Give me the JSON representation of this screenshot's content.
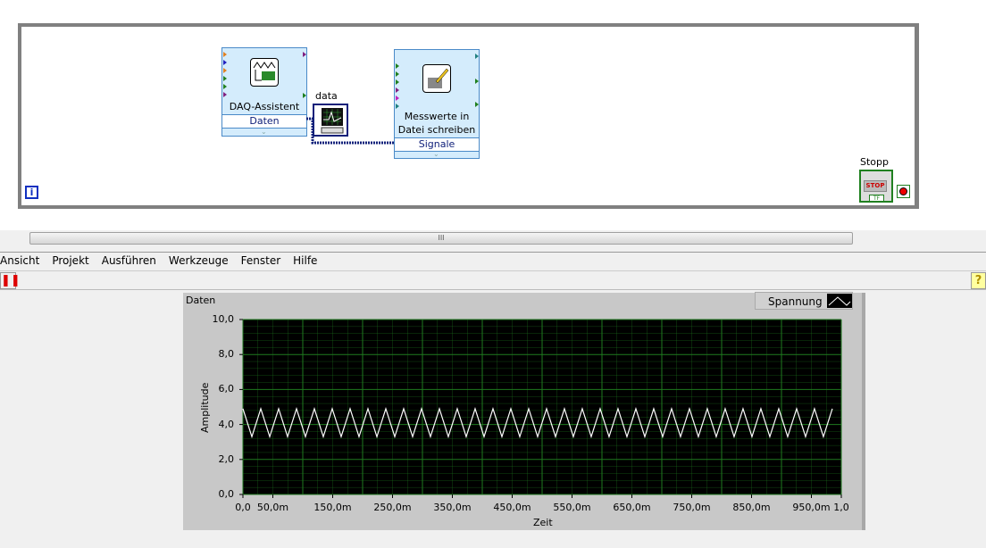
{
  "diagram": {
    "daq_node": {
      "title": "DAQ-Assistent",
      "terminal": "Daten"
    },
    "indicator_label": "data",
    "write_node": {
      "title_line1": "Messwerte in",
      "title_line2": "Datei schreiben",
      "terminal": "Signale"
    },
    "stop_label": "Stopp",
    "stop_button_text": "STOP",
    "stop_tf": "TF",
    "iteration_label": "i"
  },
  "splitter_grip": "III",
  "menu": [
    "Ansicht",
    "Projekt",
    "Ausführen",
    "Werkzeuge",
    "Fenster",
    "Hilfe"
  ],
  "graph": {
    "label": "Daten",
    "legend": "Spannung"
  },
  "colors": {
    "plot_bg": "#000000",
    "grid": "#1f7a1f",
    "trace": "#ffffff",
    "wire": "#10207a"
  },
  "chart_data": {
    "type": "line",
    "title": "Daten",
    "xlabel": "Zeit",
    "ylabel": "Amplitude",
    "xlim": [
      0,
      1
    ],
    "ylim": [
      0,
      10
    ],
    "yticks": [
      "0,0",
      "2,0",
      "4,0",
      "6,0",
      "8,0",
      "10,0"
    ],
    "xticks": [
      "0,0",
      "50,0m",
      "150,0m",
      "250,0m",
      "350,0m",
      "450,0m",
      "550,0m",
      "650,0m",
      "750,0m",
      "850,0m",
      "950,0m",
      "1,0"
    ],
    "xtick_values": [
      0,
      0.05,
      0.15,
      0.25,
      0.35,
      0.45,
      0.55,
      0.65,
      0.75,
      0.85,
      0.95,
      1.0
    ],
    "series": [
      {
        "name": "Spannung",
        "waveform": "triangle",
        "min": 3.3,
        "max": 4.9,
        "cycles": 33
      }
    ],
    "grid": true,
    "legend_placement": "top-right"
  }
}
